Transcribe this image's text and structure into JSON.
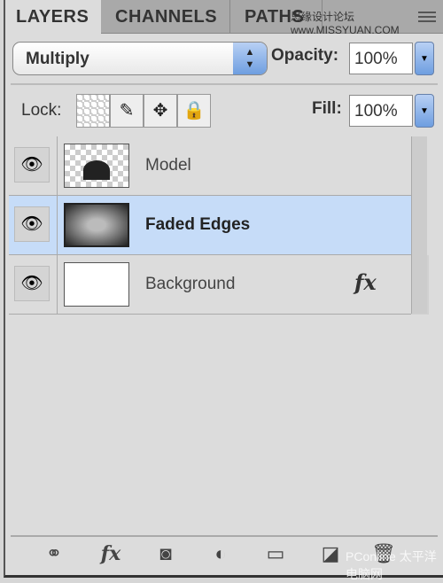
{
  "tabs": [
    {
      "label": "LAYERS",
      "active": true
    },
    {
      "label": "CHANNELS",
      "active": false
    },
    {
      "label": "PATHS",
      "active": false
    }
  ],
  "watermarks": {
    "top": "思缘设计论坛 www.MISSYUAN.COM",
    "bottom": "PConline 太平洋电脑网"
  },
  "blend_mode": "Multiply",
  "opacity": {
    "label": "Opacity:",
    "value": "100%"
  },
  "lock": {
    "label": "Lock:",
    "icons": [
      "lock-transparent-icon",
      "lock-image-icon",
      "lock-position-icon",
      "lock-all-icon"
    ]
  },
  "fill": {
    "label": "Fill:",
    "value": "100%"
  },
  "layers": [
    {
      "name": "Model",
      "visible": true,
      "selected": false
    },
    {
      "name": "Faded Edges",
      "visible": true,
      "selected": true
    },
    {
      "name": "Background",
      "visible": true,
      "selected": false,
      "fx": "fx"
    }
  ],
  "accent": "#c6dcf8",
  "bottom_toolbar": [
    "link-icon",
    "fx-icon",
    "mask-icon",
    "adjustment-icon",
    "folder-icon",
    "new-layer-icon",
    "trash-icon"
  ]
}
